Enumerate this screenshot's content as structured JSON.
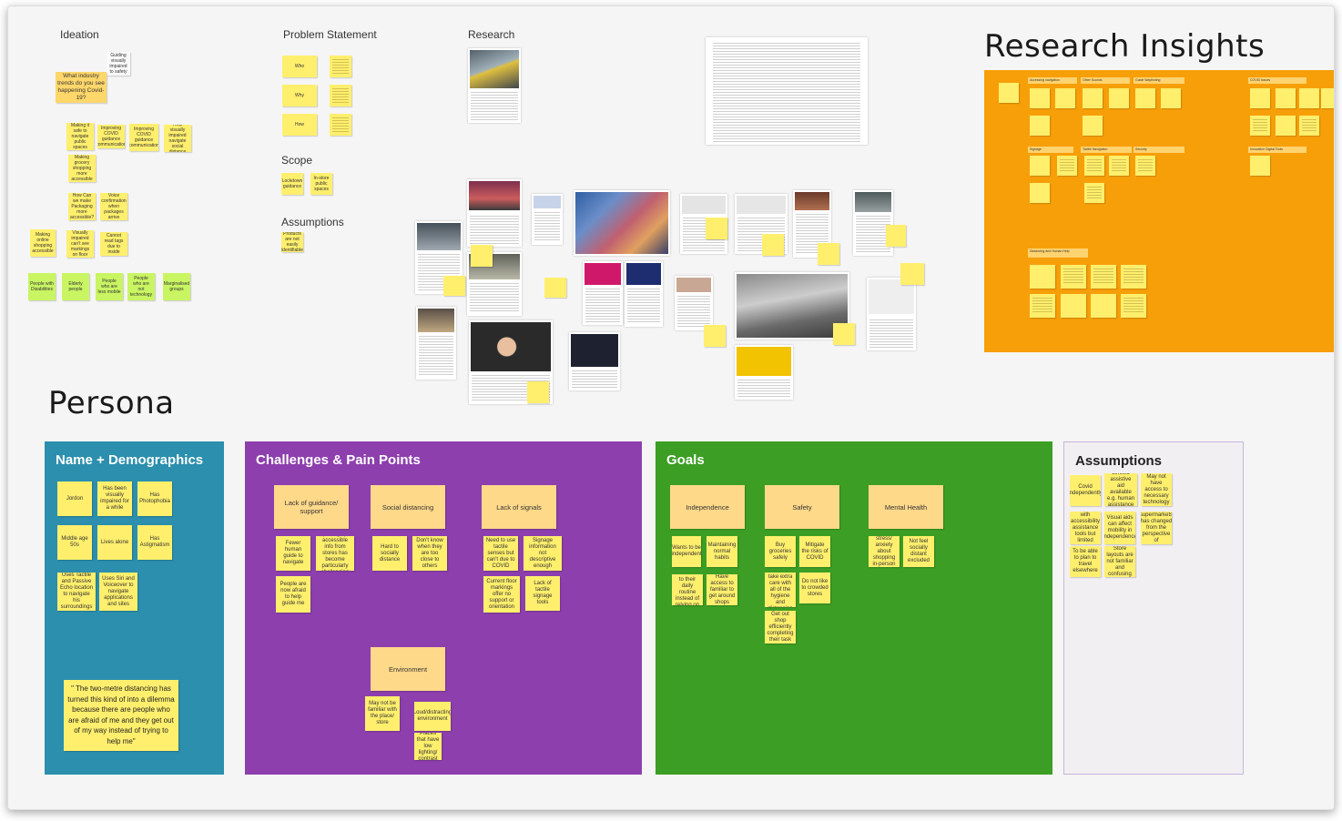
{
  "sections": {
    "ideation": "Ideation",
    "problem_statement": "Problem Statement",
    "research": "Research",
    "scope": "Scope",
    "assumptions_top": "Assumptions",
    "research_insights": "Research Insights",
    "persona": "Persona"
  },
  "ideation_notes": [
    "What industry trends do you see happening Covid-19?",
    "Guiding visually impaired to safety",
    "Making it safe to navigate public spaces",
    "Improving COVID guidance communication",
    "Help visually impaired navigate social distance",
    "Making grocery shopping more accessible",
    "How Can we make Packaging more accessible?",
    "Voice confirmation when packages arrive",
    "Making online shopping accessible",
    "Visually impaired can't see markings on floor",
    "Cannot read tags due to inside",
    "People with Disabilities",
    "Elderly people",
    "People who are less mobile",
    "People who are not technology",
    "Marginalised groups"
  ],
  "problem_notes": [
    "Who",
    "Why",
    "How"
  ],
  "scope_notes": [
    "Lockdown guidance",
    "In-store public spaces"
  ],
  "assumption_notes": [
    "Products are not easily identifiable"
  ],
  "persona": {
    "name_panel": {
      "title": "Name + Demographics",
      "notes": [
        "Jordon",
        "Has been visually impaired for a while",
        "Has Photophobia",
        "Middle age 50s",
        "Lives alone",
        "Has Astigmatism",
        "Uses Tactile and Passive Echo location to navigate his surroundings",
        "Uses Siri and Voiceover to navigate applications and sites"
      ],
      "quote": "\" The two-metre distancing has turned this kind of into a dilemma because there are people who are afraid of me and they get out of my way instead of trying to help me\""
    },
    "challenges_panel": {
      "title": "Challenges & Pain Points",
      "headers": [
        "Lack of guidance/ support",
        "Social distancing",
        "Lack of signals",
        "Environment"
      ],
      "notes": [
        "Fewer human guide to navigate",
        "picking up accessible info from stores has become particularly challenging",
        "People are now afraid to help guide me",
        "Hard to socially distance",
        "Don't know when they are too close to others",
        "Need to use tactile senses but can't due to COVID",
        "Signage information not descriptive enough",
        "Current floor markings offer no support or orientation",
        "Lack of tactile signage tools",
        "May not be familiar with the place/ store",
        "Loud/distracting environment",
        "Places that have low lighting/ contrast"
      ]
    },
    "goals_panel": {
      "title": "Goals",
      "headers": [
        "Independence",
        "Safety",
        "Mental Health"
      ],
      "notes": [
        "Wants to be independent",
        "Maintaining normal habits",
        "Find solutions to their daily routine instead of relying on others",
        "Have access to familiar to get around shops",
        "Buy groceries safely",
        "Mitigate the risks of COVID",
        "Wants to take extra care with all of the hygiene and distancing",
        "Do not like to crowded stores",
        "Get out shop efficiently completing their task",
        "Less stress/ anxiety about shopping in-person spaces",
        "Not feel socially distant excluded"
      ]
    },
    "assumptions_panel": {
      "title": "Assumptions",
      "notes": [
        "Covid independently",
        "Limited assistive aid available e.g. human assistance",
        "May not have access to necessary technology",
        "Familiar with accessibility assistance tools but limited support",
        "Visual aids can affect mobility in independence",
        "The layout of supermarkets has changed from the perspective of accessibility",
        "To be able to plan to travel elsewhere",
        "Store layouts are not familiar and confusing"
      ]
    }
  },
  "research_insights_headers": [
    "Accessing navigation",
    "Other Sounds",
    "Guide Wayfinding",
    "COVID Issues",
    "Signage",
    "Tactile Navigation",
    "Security",
    "Innovation Digital Tools",
    "Distancing and Human Help"
  ],
  "research_captions": [
    "Wayfinding in the tactile paving for visually impaired",
    "Visually impaired in supermarket",
    "Voice assistant",
    "Tactile signage",
    "Info",
    "CNIB",
    "INCA",
    "Tactile flooring",
    "Guiding Tech: Independence for visually impaired people"
  ],
  "colors": {
    "insights_bg": "#f79f09",
    "name_bg": "#2b8fad",
    "challenges_bg": "#8d3fad",
    "goals_bg": "#3c9e24",
    "sticky_yellow": "#ffef6d",
    "sticky_header": "#ffd98a",
    "sticky_green": "#c9f562"
  }
}
